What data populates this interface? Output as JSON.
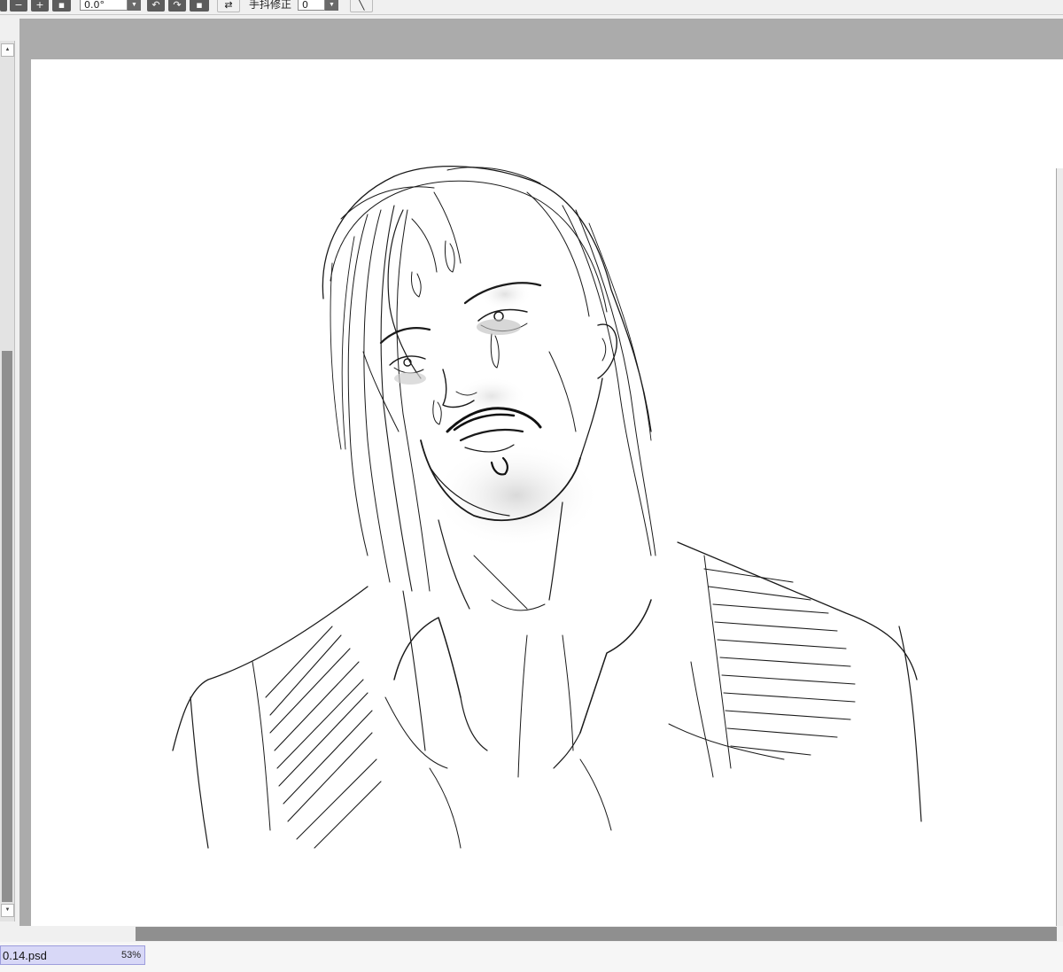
{
  "toolbar": {
    "zoom_out_label": "−",
    "zoom_in_label": "+",
    "rotation_value": "0.0°",
    "stabilizer_label": "手抖修正",
    "stabilizer_value": "0"
  },
  "status": {
    "file_name": "0.14.psd",
    "zoom": "53%"
  }
}
